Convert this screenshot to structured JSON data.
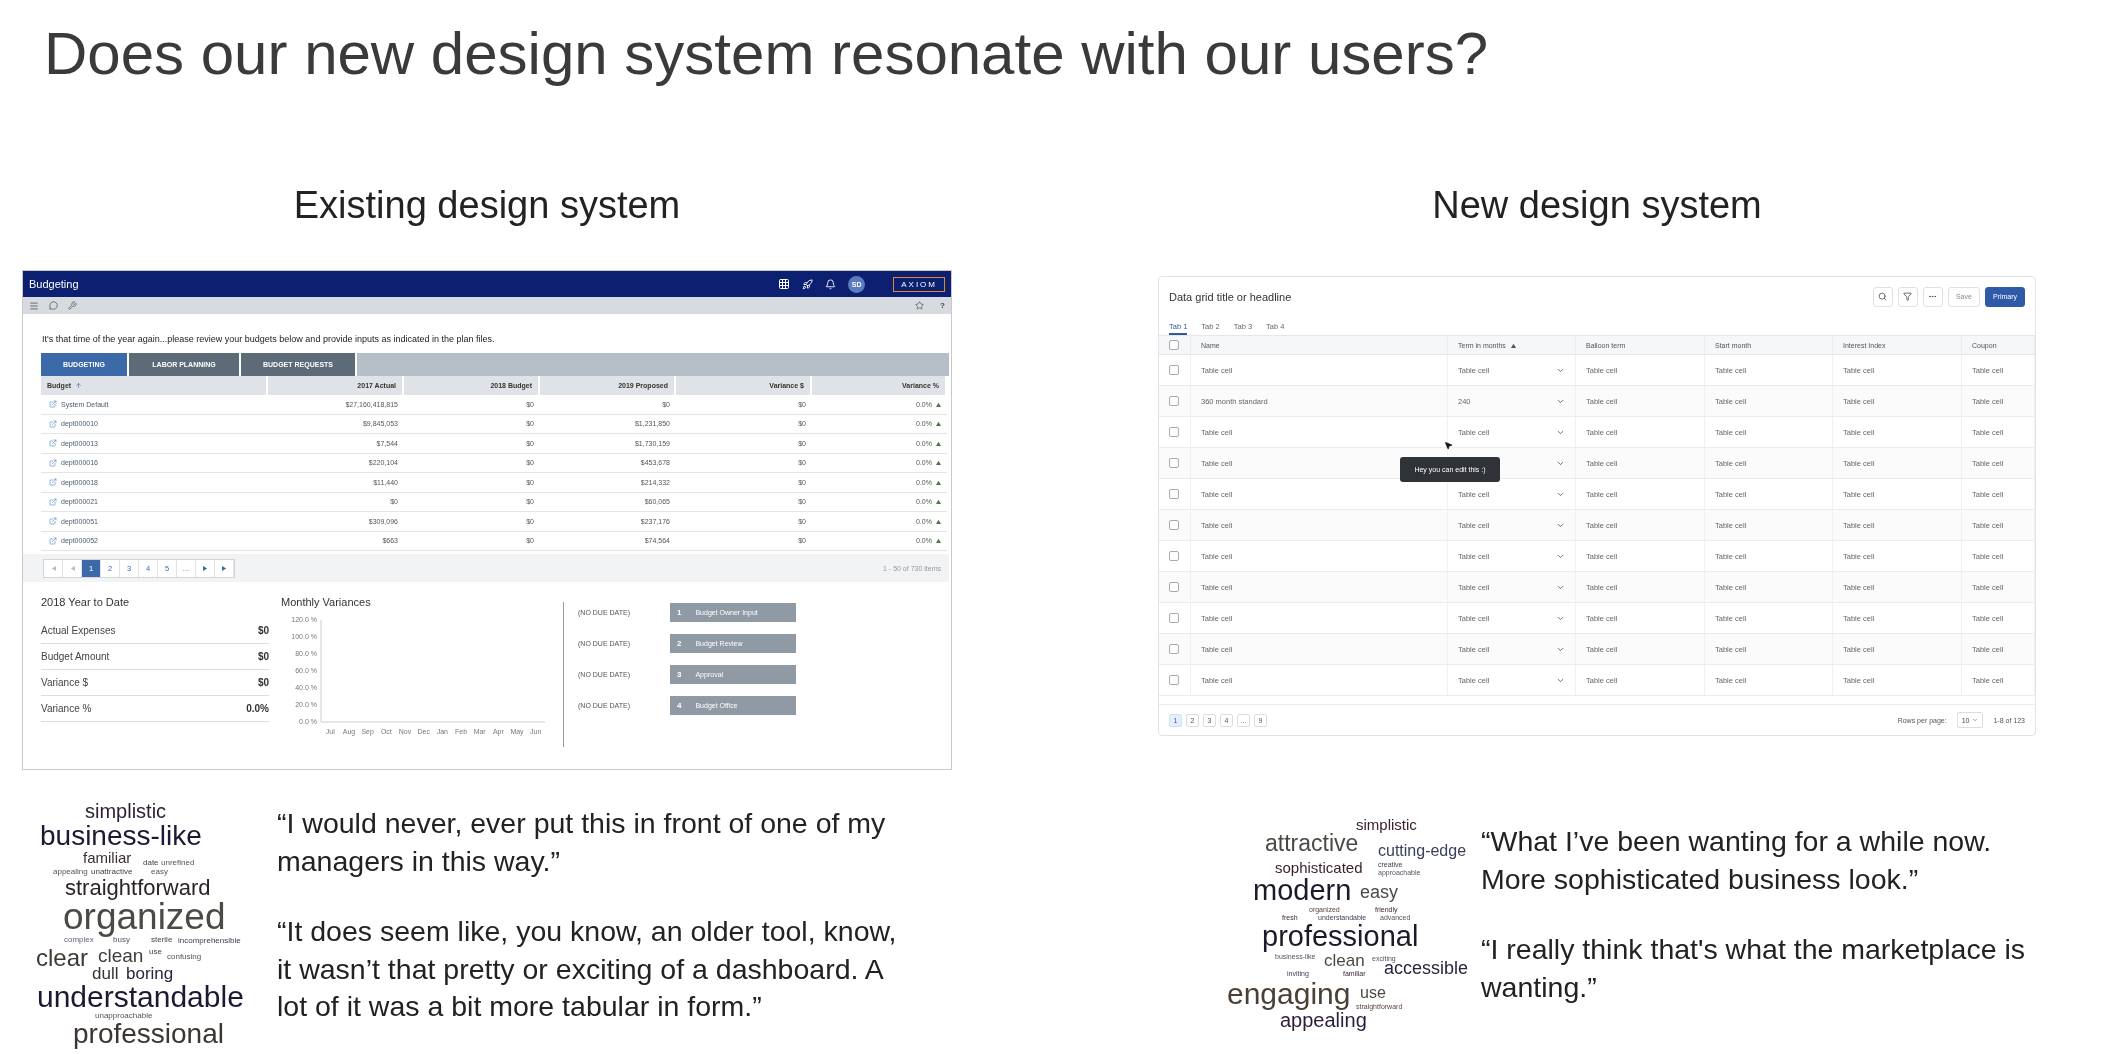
{
  "title": "Does our new design system resonate with our users?",
  "existing": {
    "heading": "Existing design system",
    "app": {
      "title": "Budgeting",
      "avatar": "SD",
      "logo": "AXIOM",
      "help": "?",
      "message": "It's that time of the year again...please review your budgets below and provide inputs as indicated in the plan files.",
      "tabs": [
        {
          "label": "BUDGETING",
          "selected": true
        },
        {
          "label": "LABOR PLANNING",
          "selected": false
        },
        {
          "label": "BUDGET REQUESTS",
          "selected": false
        }
      ],
      "columns": [
        "Budget",
        "2017 Actual",
        "2018 Budget",
        "2019 Proposed",
        "Variance $",
        "Variance %"
      ],
      "rows": [
        [
          "System Default",
          "$27,160,418,815",
          "$0",
          "$0",
          "$0",
          "0.0%"
        ],
        [
          "dept000010",
          "$9,845,053",
          "$0",
          "$1,231,850",
          "$0",
          "0.0%"
        ],
        [
          "dept000013",
          "$7,544",
          "$0",
          "$1,730,159",
          "$0",
          "0.0%"
        ],
        [
          "dept000016",
          "$220,104",
          "$0",
          "$453,678",
          "$0",
          "0.0%"
        ],
        [
          "dept000018",
          "$11,440",
          "$0",
          "$214,332",
          "$0",
          "0.0%"
        ],
        [
          "dept000021",
          "$0",
          "$0",
          "$60,065",
          "$0",
          "0.0%"
        ],
        [
          "dept000051",
          "$309,096",
          "$0",
          "$237,176",
          "$0",
          "0.0%"
        ],
        [
          "dept000052",
          "$663",
          "$0",
          "$74,564",
          "$0",
          "0.0%"
        ]
      ],
      "pages": [
        {
          "label": "1",
          "selected": true
        },
        {
          "label": "2",
          "selected": false
        },
        {
          "label": "3",
          "selected": false
        },
        {
          "label": "4",
          "selected": false
        },
        {
          "label": "5",
          "selected": false
        },
        {
          "label": "...",
          "selected": false
        }
      ],
      "item_count": "1 - 50 of 730 items",
      "summary": {
        "title": "2018 Year to Date",
        "rows": [
          {
            "label": "Actual Expenses",
            "value": "$0"
          },
          {
            "label": "Budget Amount",
            "value": "$0"
          },
          {
            "label": "Variance $",
            "value": "$0"
          },
          {
            "label": "Variance %",
            "value": "0.0%"
          }
        ]
      },
      "chart": {
        "chart_data": {
          "type": "line",
          "title": "Monthly Variances",
          "categories": [
            "Jul",
            "Aug",
            "Sep",
            "Oct",
            "Nov",
            "Dec",
            "Jan",
            "Feb",
            "Mar",
            "Apr",
            "May",
            "Jun"
          ],
          "ylim": [
            0,
            120
          ],
          "yticks": [
            {
              "value": 0,
              "label": "0.0 %"
            },
            {
              "value": 20,
              "label": "20.0 %"
            },
            {
              "value": 40,
              "label": "40.0 %"
            },
            {
              "value": 60,
              "label": "60.0 %"
            },
            {
              "value": 80,
              "label": "80.0 %"
            },
            {
              "value": 100,
              "label": "100.0 %"
            },
            {
              "value": 120,
              "label": "120.0 %"
            }
          ]
        }
      },
      "steps": [
        {
          "due": "(NO DUE DATE)",
          "number": "1",
          "label": "Budget Owner Input"
        },
        {
          "due": "(NO DUE DATE)",
          "number": "2",
          "label": "Budget Review"
        },
        {
          "due": "(NO DUE DATE)",
          "number": "3",
          "label": "Approval"
        },
        {
          "due": "(NO DUE DATE)",
          "number": "4",
          "label": "Budget Office"
        }
      ]
    },
    "word_cloud": [
      "simplistic",
      "business-like",
      "familiar",
      "date",
      "unrefined",
      "appealing",
      "unattractive",
      "easy",
      "straightforward",
      "organized",
      "complex",
      "busy",
      "sterile",
      "incomprehensible",
      "clear",
      "clean",
      "use",
      "confusing",
      "dull",
      "boring",
      "understandable",
      "unapproachable",
      "professional"
    ],
    "quotes": [
      "“I would never, ever put this in front of one of my managers in this way.”",
      "“It does seem like, you know, an older tool, know, it wasn’t that pretty or exciting of a dashboard. A lot of it was a bit more tabular in form.”"
    ]
  },
  "new": {
    "heading": "New design system",
    "grid": {
      "title": "Data grid title or headline",
      "buttons": [
        {
          "kind": "secondary",
          "label": "Save"
        },
        {
          "kind": "primary",
          "label": "Primary"
        }
      ],
      "tabs": [
        {
          "label": "Tab 1",
          "selected": true
        },
        {
          "label": "Tab 2",
          "selected": false
        },
        {
          "label": "Tab 3",
          "selected": false
        },
        {
          "label": "Tab 4",
          "selected": false
        }
      ],
      "select_all": {
        "checked": false
      },
      "columns": [
        "Name",
        "Term in months",
        "Balloon term",
        "Start month",
        "Interest Index",
        "Coupon"
      ],
      "rows": [
        {
          "checked": false,
          "name": "Table cell",
          "term": "Table cell",
          "balloon": "Table cell",
          "start": "Table cell",
          "interest": "Table cell",
          "coupon": "Table cell"
        },
        {
          "checked": false,
          "name": "360 month standard",
          "term": "240",
          "balloon": "Table cell",
          "start": "Table cell",
          "interest": "Table cell",
          "coupon": "Table cell"
        },
        {
          "checked": false,
          "name": "Table cell",
          "term": "Table cell",
          "balloon": "Table cell",
          "start": "Table cell",
          "interest": "Table cell",
          "coupon": "Table cell"
        },
        {
          "checked": false,
          "name": "Table cell",
          "balloon": "Table cell",
          "start": "Table cell",
          "interest": "Table cell",
          "coupon": "Table cell"
        },
        {
          "checked": false,
          "name": "Table cell",
          "term": "Table cell",
          "balloon": "Table cell",
          "start": "Table cell",
          "interest": "Table cell",
          "coupon": "Table cell"
        },
        {
          "checked": false,
          "name": "Table cell",
          "term": "Table cell",
          "balloon": "Table cell",
          "start": "Table cell",
          "interest": "Table cell",
          "coupon": "Table cell"
        },
        {
          "checked": false,
          "name": "Table cell",
          "term": "Table cell",
          "balloon": "Table cell",
          "start": "Table cell",
          "interest": "Table cell",
          "coupon": "Table cell"
        },
        {
          "checked": false,
          "name": "Table cell",
          "term": "Table cell",
          "balloon": "Table cell",
          "start": "Table cell",
          "interest": "Table cell",
          "coupon": "Table cell"
        },
        {
          "checked": false,
          "name": "Table cell",
          "term": "Table cell",
          "balloon": "Table cell",
          "start": "Table cell",
          "interest": "Table cell",
          "coupon": "Table cell"
        },
        {
          "checked": false,
          "name": "Table cell",
          "term": "Table cell",
          "balloon": "Table cell",
          "start": "Table cell",
          "interest": "Table cell",
          "coupon": "Table cell"
        },
        {
          "checked": false,
          "name": "Table cell",
          "term": "Table cell",
          "balloon": "Table cell",
          "start": "Table cell",
          "interest": "Table cell",
          "coupon": "Table cell"
        }
      ],
      "tooltip": "Hey you can edit this :)",
      "pages": [
        {
          "label": "1",
          "selected": true
        },
        {
          "label": "2",
          "selected": false
        },
        {
          "label": "3",
          "selected": false
        },
        {
          "label": "4",
          "selected": false
        },
        {
          "label": "…",
          "selected": false
        },
        {
          "label": "9",
          "selected": false
        }
      ],
      "rows_per_page_label": "Rows per page:",
      "rows_per_page": "10",
      "count": "1-8 of 123"
    },
    "word_cloud": [
      "simplistic",
      "attractive",
      "cutting-edge",
      "sophisticated",
      "creative",
      "approachable",
      "modern",
      "easy",
      "organized",
      "friendly",
      "fresh",
      "understandable",
      "advanced",
      "professional",
      "business-like",
      "clean",
      "exciting",
      "inviting",
      "familiar",
      "accessible",
      "engaging",
      "use",
      "straightforward",
      "appealing"
    ],
    "quotes": [
      "“What I’ve been wanting for a while now. More sophisticated business look.”",
      "“I really think that's what the marketplace is wanting.”"
    ]
  }
}
